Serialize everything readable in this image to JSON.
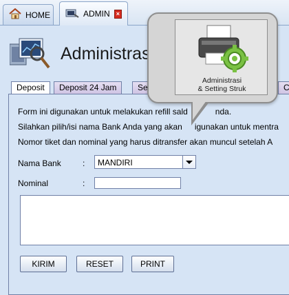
{
  "top_tabs": [
    {
      "label": "HOME",
      "icon": "home-icon"
    },
    {
      "label": "ADMIN",
      "icon": "admin-icon",
      "close_icon": "close-icon"
    }
  ],
  "page": {
    "title": "Administrasi"
  },
  "sub_tabs": [
    {
      "label": "Deposit"
    },
    {
      "label": "Deposit 24 Jam"
    },
    {
      "label": "Set"
    },
    {
      "label": "Ce"
    }
  ],
  "form": {
    "instructions": [
      "Form ini digunakan untuk melakukan refill sald",
      "Silahkan pilih/isi nama Bank Anda yang akan",
      "Nomor tiket dan nominal yang harus ditransfer akan muncul setelah A"
    ],
    "instruction_tail_1": "nda.",
    "instruction_tail_2": "igunakan untuk mentra",
    "bank_label": "Nama Bank",
    "bank_colon": ":",
    "bank_value": "MANDIRI",
    "nominal_label": "Nominal",
    "nominal_colon": ":",
    "nominal_value": "",
    "notes_value": ""
  },
  "buttons": {
    "kirim": "KIRIM",
    "reset": "RESET",
    "print": "PRINT"
  },
  "callout": {
    "line1": "Administrasi",
    "line2": "& Setting Struk",
    "icon": "printer-settings-icon"
  },
  "colors": {
    "accent": "#d6e4f5",
    "close": "#d52b1e",
    "callout": "#d5d5d5",
    "gear": "#7ac143"
  }
}
